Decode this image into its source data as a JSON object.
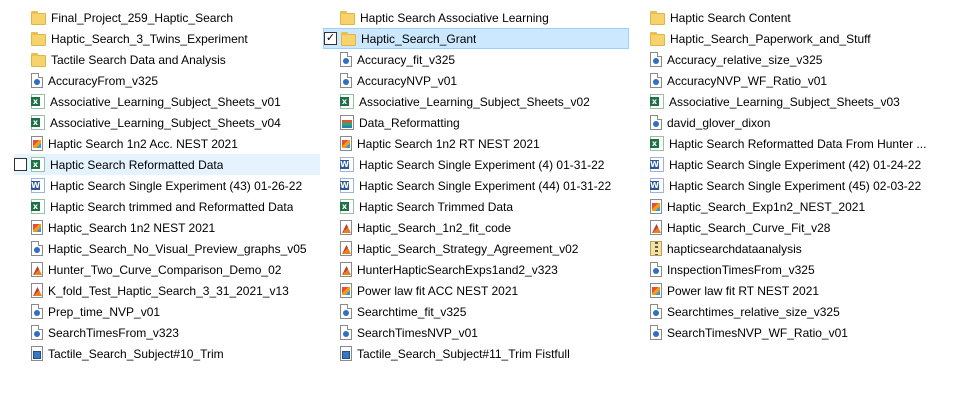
{
  "columns": [
    {
      "items": [
        {
          "label": "Final_Project_259_Haptic_Search",
          "icon": "folder-icon"
        },
        {
          "label": "Haptic_Search_3_Twins_Experiment",
          "icon": "folder-icon"
        },
        {
          "label": "Tactile Search Data and Analysis",
          "icon": "folder-icon"
        },
        {
          "label": "AccuracyFrom_v325",
          "icon": "data-file-icon"
        },
        {
          "label": "Associative_Learning_Subject_Sheets_v01",
          "icon": "excel-icon"
        },
        {
          "label": "Associative_Learning_Subject_Sheets_v04",
          "icon": "excel-icon"
        },
        {
          "label": "Haptic Search 1n2 Acc. NEST 2021",
          "icon": "figure-icon"
        },
        {
          "label": "Haptic Search Reformatted Data",
          "icon": "excel-icon",
          "state": "hover"
        },
        {
          "label": "Haptic Search Single Experiment (43) 01-26-22",
          "icon": "word-icon"
        },
        {
          "label": "Haptic Search trimmed and Reformatted Data",
          "icon": "excel-icon"
        },
        {
          "label": "Haptic_Search 1n2 NEST 2021",
          "icon": "figure-icon"
        },
        {
          "label": "Haptic_Search_No_Visual_Preview_graphs_v05",
          "icon": "data-file-icon"
        },
        {
          "label": "Hunter_Two_Curve_Comparison_Demo_02",
          "icon": "script-icon"
        },
        {
          "label": "K_fold_Test_Haptic_Search_3_31_2021_v13",
          "icon": "script-icon"
        },
        {
          "label": "Prep_time_NVP_v01",
          "icon": "data-file-icon"
        },
        {
          "label": "SearchTimesFrom_v323",
          "icon": "data-file-icon"
        },
        {
          "label": "Tactile_Search_Subject#10_Trim",
          "icon": "mat-file-icon"
        }
      ]
    },
    {
      "items": [
        {
          "label": "Haptic Search Associative Learning",
          "icon": "folder-icon"
        },
        {
          "label": "Haptic_Search_Grant",
          "icon": "folder-icon",
          "state": "selected"
        },
        {
          "label": "Accuracy_fit_v325",
          "icon": "data-file-icon"
        },
        {
          "label": "AccuracyNVP_v01",
          "icon": "data-file-icon"
        },
        {
          "label": "Associative_Learning_Subject_Sheets_v02",
          "icon": "excel-icon"
        },
        {
          "label": "Data_Reformatting",
          "icon": "app-icon"
        },
        {
          "label": "Haptic Search 1n2 RT NEST 2021",
          "icon": "figure-icon"
        },
        {
          "label": "Haptic Search Single Experiment (4) 01-31-22",
          "icon": "word-icon"
        },
        {
          "label": "Haptic Search Single Experiment (44) 01-31-22",
          "icon": "word-icon"
        },
        {
          "label": "Haptic Search Trimmed Data",
          "icon": "excel-icon"
        },
        {
          "label": "Haptic_Search_1n2_fit_code",
          "icon": "script-icon"
        },
        {
          "label": "Haptic_Search_Strategy_Agreement_v02",
          "icon": "script-icon"
        },
        {
          "label": "HunterHapticSearchExps1and2_v323",
          "icon": "script-icon"
        },
        {
          "label": "Power law fit ACC NEST 2021",
          "icon": "figure-icon"
        },
        {
          "label": "Searchtime_fit_v325",
          "icon": "data-file-icon"
        },
        {
          "label": "SearchTimesNVP_v01",
          "icon": "data-file-icon"
        },
        {
          "label": "Tactile_Search_Subject#11_Trim  Fistfull",
          "icon": "mat-file-icon"
        }
      ]
    },
    {
      "items": [
        {
          "label": "Haptic Search Content",
          "icon": "folder-icon"
        },
        {
          "label": "Haptic_Search_Paperwork_and_Stuff",
          "icon": "folder-icon"
        },
        {
          "label": "Accuracy_relative_size_v325",
          "icon": "data-file-icon"
        },
        {
          "label": "AccuracyNVP_WF_Ratio_v01",
          "icon": "data-file-icon"
        },
        {
          "label": "Associative_Learning_Subject_Sheets_v03",
          "icon": "excel-icon"
        },
        {
          "label": "david_glover_dixon",
          "icon": "data-file-icon"
        },
        {
          "label": "Haptic Search Reformatted Data From Hunter ...",
          "icon": "excel-icon"
        },
        {
          "label": "Haptic Search Single Experiment (42) 01-24-22",
          "icon": "word-icon"
        },
        {
          "label": "Haptic Search Single Experiment (45) 02-03-22",
          "icon": "word-icon"
        },
        {
          "label": "Haptic_Search_Exp1n2_NEST_2021",
          "icon": "figure-icon"
        },
        {
          "label": "Haptic_Search_Curve_Fit_v28",
          "icon": "script-icon"
        },
        {
          "label": "hapticsearchdataanalysis",
          "icon": "zip-icon"
        },
        {
          "label": "InspectionTimesFrom_v325",
          "icon": "data-file-icon"
        },
        {
          "label": "Power law fit RT NEST 2021",
          "icon": "figure-icon"
        },
        {
          "label": "Searchtimes_relative_size_v325",
          "icon": "data-file-icon"
        },
        {
          "label": "SearchTimesNVP_WF_Ratio_v01",
          "icon": "data-file-icon"
        }
      ]
    }
  ]
}
